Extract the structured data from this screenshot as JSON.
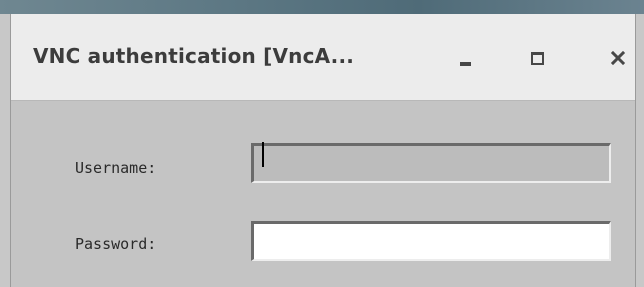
{
  "window": {
    "title": "VNC authentication [VncA..."
  },
  "controls": {
    "minimize_icon": "minimize-icon",
    "maximize_icon": "maximize-icon",
    "close_icon": "close-icon"
  },
  "form": {
    "username_label": "Username:",
    "username_value": "",
    "password_label": "Password:",
    "password_value": ""
  },
  "colors": {
    "titlebar_bg": "#ececec",
    "content_bg": "#c4c4c4",
    "title_text": "#3c3c3c"
  }
}
